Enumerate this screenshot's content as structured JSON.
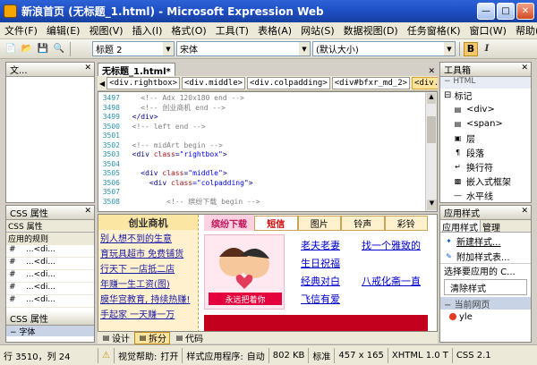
{
  "window": {
    "title": "新浪首页 (无标题_1.html) - Microsoft Expression Web"
  },
  "menu": [
    "文件(F)",
    "编辑(E)",
    "视图(V)",
    "插入(I)",
    "格式(O)",
    "工具(T)",
    "表格(A)",
    "网站(S)",
    "数据视图(D)",
    "任务窗格(K)",
    "窗口(W)",
    "帮助(H)"
  ],
  "toolbar": {
    "style_value": "标题 2",
    "font_value": "宋体",
    "size_value": "(默认大小)",
    "bold_label": "B",
    "italic_label": "I"
  },
  "left_panels": {
    "top_title": "文...",
    "css_title": "CSS 属性",
    "css_tabs": [
      "CSS 属性",
      "应用的规则"
    ],
    "css_rows": [
      [
        "#",
        "...<di..."
      ],
      [
        "#",
        "...<di..."
      ],
      [
        "#",
        "...<di..."
      ],
      [
        "#",
        "...<di..."
      ],
      [
        "#",
        "...<di..."
      ]
    ],
    "lower_title": "CSS 属性",
    "lower_section": "字体"
  },
  "document": {
    "tab_label": "无标题_1.html*",
    "breadcrumbs": [
      "<div.rightbox>",
      "<div.middle>",
      "<div.colpadding>",
      "<div#bfxr_md_2>",
      "<div.hd_2>"
    ]
  },
  "code_lines": [
    {
      "n": "3497",
      "indent": 4,
      "parts": [
        {
          "t": "<!-- Adx 120x180 end -->",
          "c": "cm"
        }
      ]
    },
    {
      "n": "3498",
      "indent": 4,
      "parts": [
        {
          "t": "<!-- 创业商机 end -->",
          "c": "cm"
        }
      ]
    },
    {
      "n": "3499",
      "indent": 2,
      "parts": [
        {
          "t": "</div>",
          "c": "tg"
        }
      ]
    },
    {
      "n": "3500",
      "indent": 2,
      "parts": [
        {
          "t": "<!-- left end -->",
          "c": "cm"
        }
      ]
    },
    {
      "n": "3501",
      "indent": 0,
      "parts": []
    },
    {
      "n": "3502",
      "indent": 2,
      "parts": [
        {
          "t": "<!-- midArt begin -->",
          "c": "cm"
        }
      ]
    },
    {
      "n": "3503",
      "indent": 2,
      "parts": [
        {
          "t": "<div ",
          "c": "tg"
        },
        {
          "t": "class",
          "c": "an"
        },
        {
          "t": "=",
          "c": "tg"
        },
        {
          "t": "\"rightbox\"",
          "c": "av"
        },
        {
          "t": ">",
          "c": "tg"
        }
      ]
    },
    {
      "n": "3504",
      "indent": 0,
      "parts": []
    },
    {
      "n": "3505",
      "indent": 4,
      "parts": [
        {
          "t": "<div ",
          "c": "tg"
        },
        {
          "t": "class",
          "c": "an"
        },
        {
          "t": "=",
          "c": "tg"
        },
        {
          "t": "\"middle\"",
          "c": "av"
        },
        {
          "t": ">",
          "c": "tg"
        }
      ]
    },
    {
      "n": "3506",
      "indent": 6,
      "parts": [
        {
          "t": "<div ",
          "c": "tg"
        },
        {
          "t": "class",
          "c": "an"
        },
        {
          "t": "=",
          "c": "tg"
        },
        {
          "t": "\"colpadding\"",
          "c": "av"
        },
        {
          "t": ">",
          "c": "tg"
        }
      ]
    },
    {
      "n": "3507",
      "indent": 0,
      "parts": []
    },
    {
      "n": "3508",
      "indent": 10,
      "parts": [
        {
          "t": "<!-- 缤纷下载 begin -->",
          "c": "cm"
        }
      ]
    }
  ],
  "design": {
    "left_heading": "创业商机",
    "left_links": [
      "别人想不到的生意",
      "育玩具超市  免费铺货",
      "行天下  一店抵二店",
      "年赚一生工资(图)",
      "膜华宫教育, 持续热赚!",
      "手起家  一天赚一万"
    ],
    "news_tabs": [
      "短信",
      "图片",
      "铃声",
      "彩铃"
    ],
    "news_logo": "缤纷下载",
    "banner_caption": "永远把着你",
    "col1_links": [
      "老夫老妻",
      "生日祝福",
      "经典对白",
      "飞信有爱"
    ],
    "col2_links": [
      "找一个雅致的",
      "",
      "八戒化斋一直",
      ""
    ]
  },
  "view_buttons": [
    "设计",
    "拆分",
    "代码"
  ],
  "toolbox": {
    "title": "工具箱",
    "section": "HTML",
    "group": "标记",
    "items": [
      "<div>",
      "<span>",
      "层",
      "段落",
      "换行符",
      "嵌入式框架",
      "水平线"
    ]
  },
  "styles_panel": {
    "title": "应用样式",
    "tabs": [
      "应用样式",
      "管理"
    ],
    "new_style": "新建样式...",
    "attach": "附加样式表...",
    "select_label": "选择要应用的 C...",
    "clear": "清除样式",
    "current": "当前网页",
    "style_item": "yle"
  },
  "status": {
    "pos": "行 3510，列 24",
    "help": "视觉帮助:",
    "help_val": "打开",
    "app": "样式应用程序:",
    "app_val": "自动",
    "size": "802 KB",
    "mode": "标准",
    "dims": "457 x 165",
    "doctype": "XHTML 1.0 T",
    "css": "CSS 2.1"
  }
}
